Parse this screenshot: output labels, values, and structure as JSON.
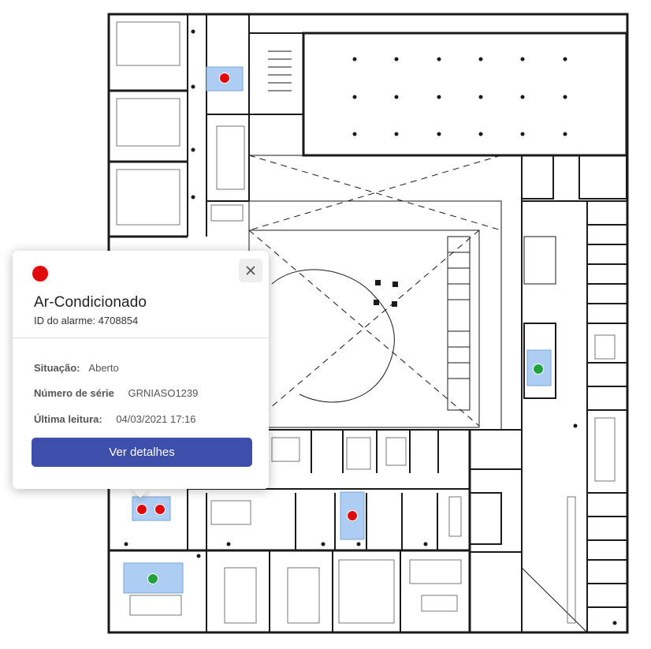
{
  "popup": {
    "status_color": "#e10a0a",
    "title": "Ar-Condicionado",
    "alarm_id": "ID do alarme: 4708854",
    "close_icon": "close-icon",
    "fields": [
      {
        "label": "Situação:",
        "value": "Aberto"
      },
      {
        "label": "Número de série",
        "value": "GRNIASO1239"
      },
      {
        "label": "Última leitura:",
        "value": "04/03/2021 17:16"
      }
    ],
    "button_label": "Ver detalhes"
  },
  "floorplan": {
    "marker_colors": {
      "alarm": "#e10a0a",
      "ok": "#22a23c",
      "zone": "#aecdf2"
    },
    "markers": [
      {
        "status": "alarm"
      },
      {
        "status": "ok"
      },
      {
        "status": "alarm"
      },
      {
        "status": "alarm"
      },
      {
        "status": "alarm"
      },
      {
        "status": "ok"
      }
    ]
  }
}
